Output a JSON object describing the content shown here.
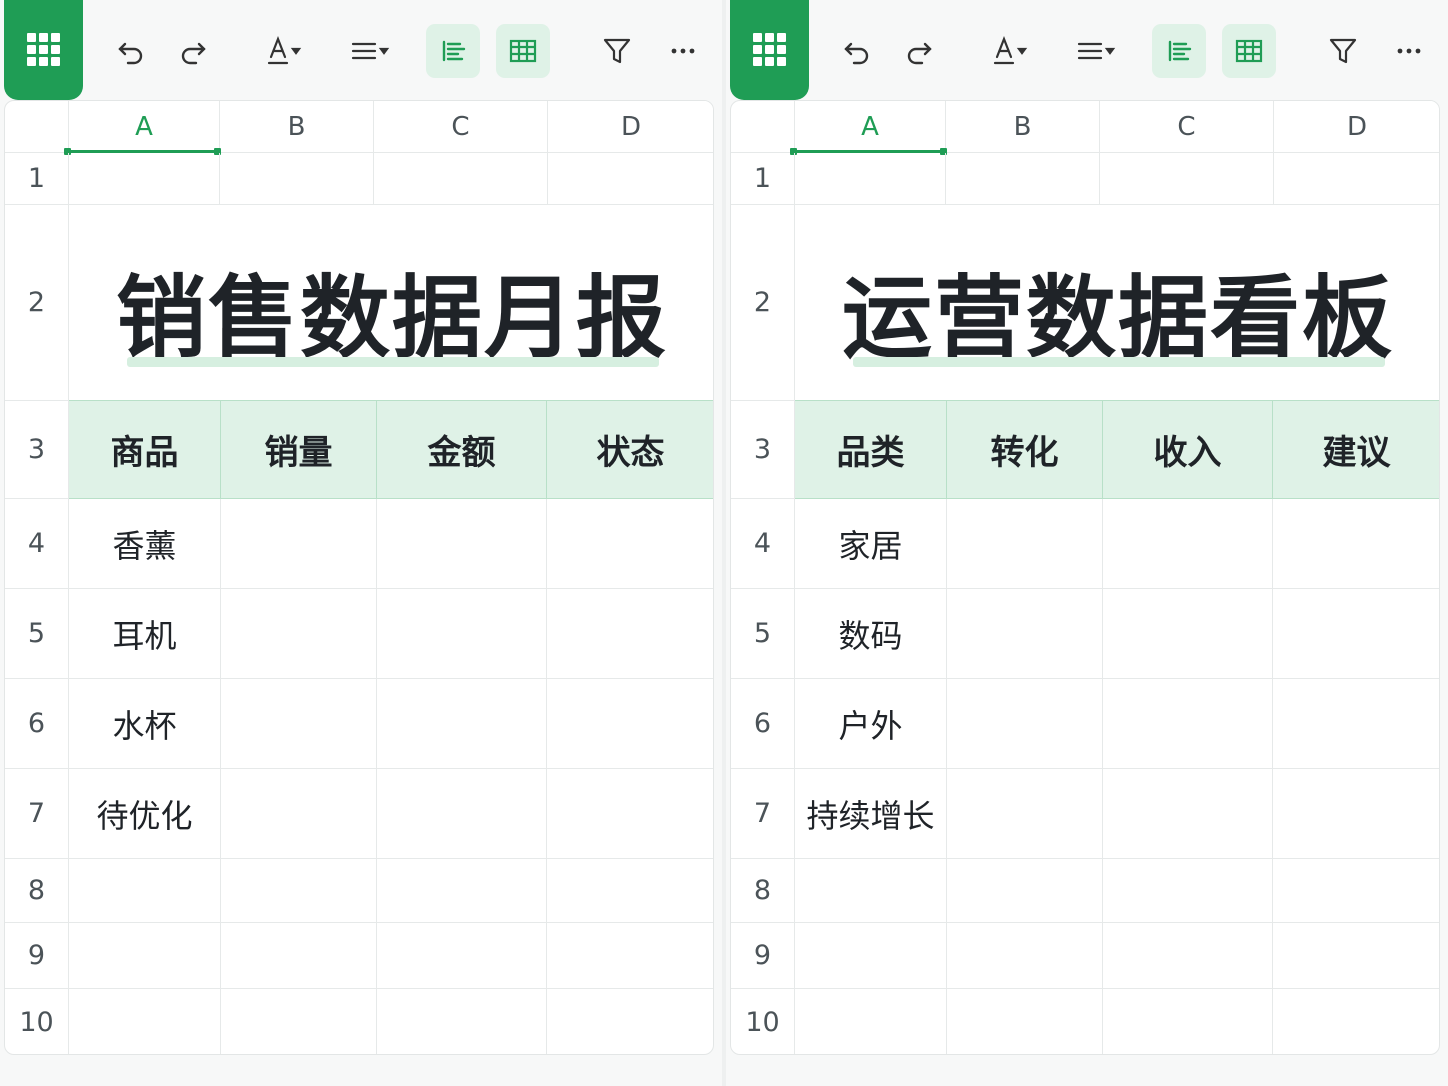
{
  "toolbar": {
    "icons": [
      "grid-app-icon",
      "undo-icon",
      "redo-icon",
      "font-color-icon",
      "align-menu-icon",
      "left-align-icon",
      "table-icon",
      "filter-icon",
      "more-icon"
    ],
    "accent": "#1f9d55",
    "active_bg": "#dff2e7"
  },
  "columns": [
    "A",
    "B",
    "C",
    "D"
  ],
  "rows": [
    "1",
    "2",
    "3",
    "4",
    "5",
    "6",
    "7",
    "8",
    "9",
    "10"
  ],
  "left": {
    "title": "销售数据月报",
    "headers": [
      "商品",
      "销量",
      "金额",
      "状态"
    ],
    "items": [
      "香薰",
      "耳机",
      "水杯",
      "待优化"
    ]
  },
  "right": {
    "title": "运营数据看板",
    "headers": [
      "品类",
      "转化",
      "收入",
      "建议"
    ],
    "items": [
      "家居",
      "数码",
      "户外",
      "持续增长"
    ]
  }
}
